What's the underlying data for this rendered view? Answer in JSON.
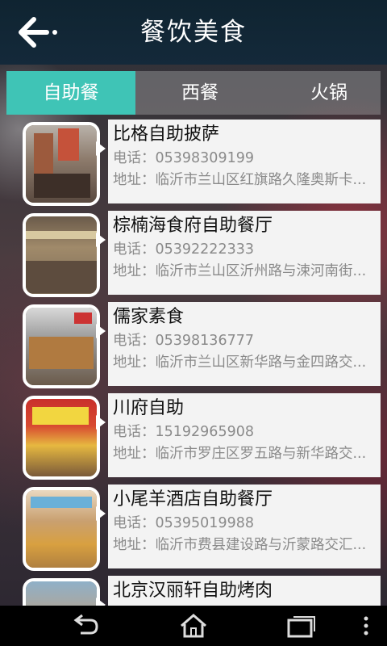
{
  "header": {
    "title": "餐饮美食"
  },
  "tabs": [
    {
      "label": "自助餐",
      "active": true
    },
    {
      "label": "西餐",
      "active": false
    },
    {
      "label": "火锅",
      "active": false
    }
  ],
  "restaurants": [
    {
      "name": "比格自助披萨",
      "phone": "电话：05398309199",
      "address": "地址：临沂市兰山区红旗路久隆奥斯卡..."
    },
    {
      "name": "棕楠海食府自助餐厅",
      "phone": "电话：05392222333",
      "address": "地址：临沂市兰山区沂州路与涑河南街..."
    },
    {
      "name": "儒家素食",
      "phone": "电话：05398136777",
      "address": "地址：临沂市兰山区新华路与金四路交..."
    },
    {
      "name": "川府自助",
      "phone": "电话：15192965908",
      "address": "地址：临沂市罗庄区罗五路与新华路交..."
    },
    {
      "name": "小尾羊酒店自助餐厅",
      "phone": "电话：05395019988",
      "address": "地址：临沂市费县建设路与沂蒙路交汇..."
    },
    {
      "name": "北京汉丽轩自助烤肉",
      "phone": "",
      "address": ""
    }
  ],
  "colors": {
    "accent": "#3fc4b6",
    "header_bg": "#14293a"
  },
  "icons": {
    "back": "back-arrow-icon",
    "nav_back": "nav-back-icon",
    "nav_home": "nav-home-icon",
    "nav_recent": "nav-recent-apps-icon",
    "nav_menu": "nav-menu-icon"
  }
}
